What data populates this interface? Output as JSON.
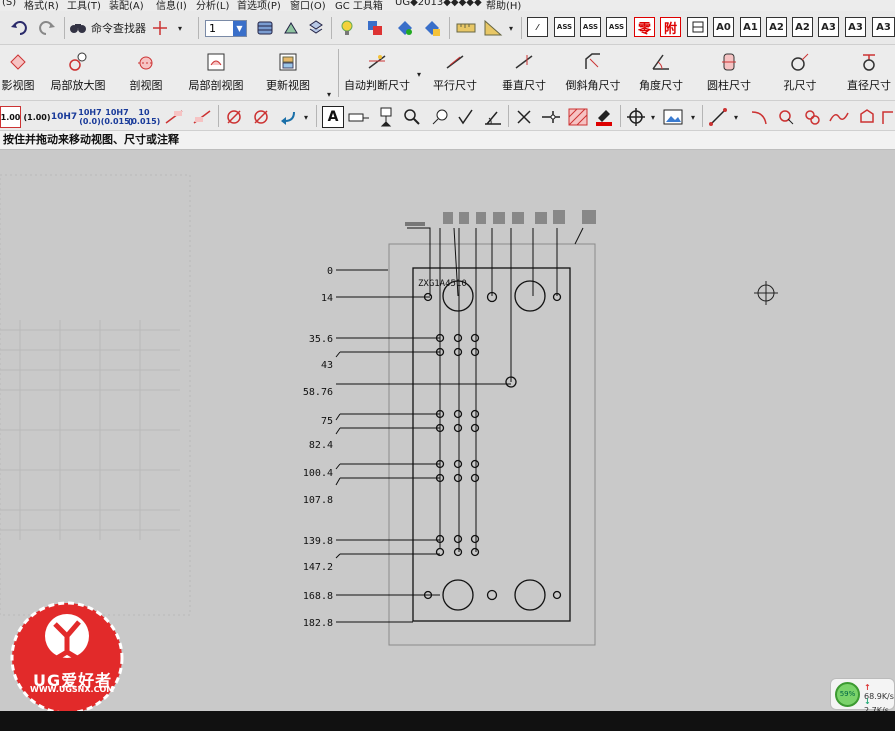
{
  "menu": [
    "(S)",
    "格式(R)",
    "工具(T)",
    "装配(A)",
    "信息(I)",
    "分析(L)",
    "首选项(P)",
    "窗口(O)",
    "GC 工具箱",
    "UG◆2013◆◆◆◆◆",
    "帮助(H)"
  ],
  "toolbar1": {
    "command_finder_label": "命令查找器",
    "layer_value": "1",
    "icon_buttons": [
      "ASS",
      "ASS",
      "ASS",
      "零",
      "附",
      "A0",
      "A1",
      "A2",
      "A3"
    ]
  },
  "toolbar2": {
    "commands": [
      "影视图",
      "局部放大图",
      "剖视图",
      "局部剖视图",
      "更新视图",
      "自动判断尺寸",
      "平行尺寸",
      "垂直尺寸",
      "倒斜角尺寸",
      "角度尺寸",
      "圆柱尺寸",
      "孔尺寸",
      "直径尺寸"
    ]
  },
  "toolbar3": {
    "tolerance_buttons": [
      "1.00",
      "(1.00)",
      "10H7",
      "10H7 (0.0)",
      "10H7 (0.015)",
      "10 (0.015)"
    ]
  },
  "cue_line": "按住并拖动来移动视图、尺寸或注释",
  "drawing": {
    "view_label": "ZXG1A4510",
    "ordinate_labels": [
      "0",
      "14",
      "35.6",
      "43",
      "58.76",
      "75",
      "82.4",
      "100.4",
      "107.8",
      "139.8",
      "147.2",
      "168.8",
      "182.8"
    ],
    "colors": {
      "line": "#111111",
      "canvas": "#c9c9c9",
      "border": "#8a8a8a"
    }
  },
  "watermark": {
    "brand": "UG爱好者",
    "url": "WWW.UGSNX.COM"
  },
  "net_widget": {
    "percent": "59%",
    "upload": "68.9K/s",
    "download": "2.7K/s"
  }
}
